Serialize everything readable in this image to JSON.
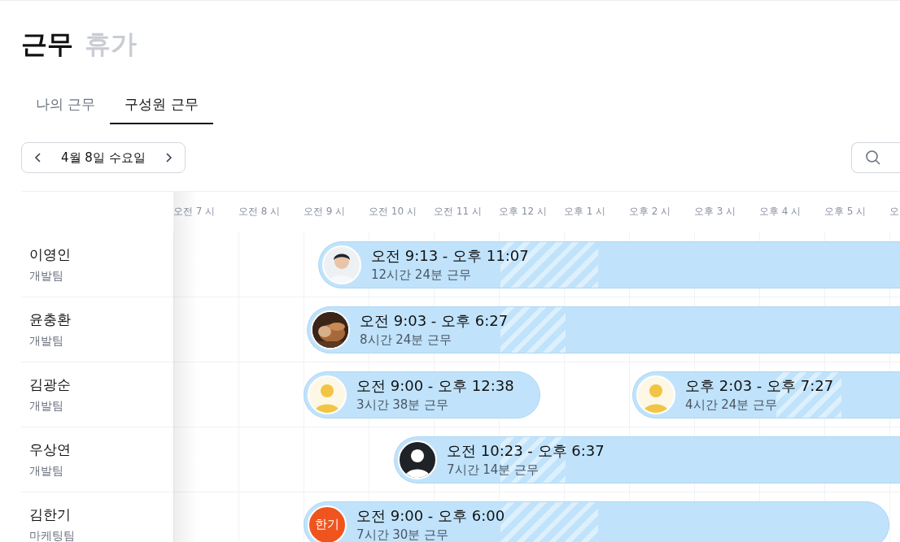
{
  "header": {
    "title": "근무",
    "secondary": "휴가"
  },
  "tabs": [
    {
      "label": "나의 근무",
      "selected": false
    },
    {
      "label": "구성원 근무",
      "selected": true
    }
  ],
  "date_nav": {
    "label": "4월 8일 수요일"
  },
  "timeline": {
    "hours": [
      "오전 7 시",
      "오전 8 시",
      "오전 9 시",
      "오전 10 시",
      "오전 11 시",
      "오후 12 시",
      "오후 1 시",
      "오후 2 시",
      "오후 3 시",
      "오후 4 시",
      "오후 5 시",
      "오"
    ]
  },
  "members": [
    {
      "name": "이영인",
      "team": "개발팀",
      "shifts": [
        {
          "time": "오전 9:13 - 오후 11:07",
          "duration": "12시간 24분 근무"
        }
      ]
    },
    {
      "name": "윤충환",
      "team": "개발팀",
      "shifts": [
        {
          "time": "오전 9:03 - 오후 6:27",
          "duration": "8시간 24분 근무"
        }
      ]
    },
    {
      "name": "김광순",
      "team": "개발팀",
      "shifts": [
        {
          "time": "오전 9:00 - 오후 12:38",
          "duration": "3시간 38분 근무",
          "avatar": {
            "kind": "default"
          }
        },
        {
          "time": "오후 2:03 - 오후 7:27",
          "duration": "4시간 24분 근무",
          "avatar": {
            "kind": "default"
          }
        }
      ]
    },
    {
      "name": "우상연",
      "team": "개발팀",
      "shifts": [
        {
          "time": "오전 10:23 - 오후 6:37",
          "duration": "7시간 14분 근무",
          "avatar": {
            "kind": "dark"
          }
        }
      ]
    },
    {
      "name": "김한기",
      "team": "마케팅팀",
      "shifts": [
        {
          "time": "오전 9:00 - 오후 6:00",
          "duration": "7시간 30분 근무",
          "avatar": {
            "kind": "initials",
            "text": "한기"
          }
        }
      ]
    }
  ]
}
